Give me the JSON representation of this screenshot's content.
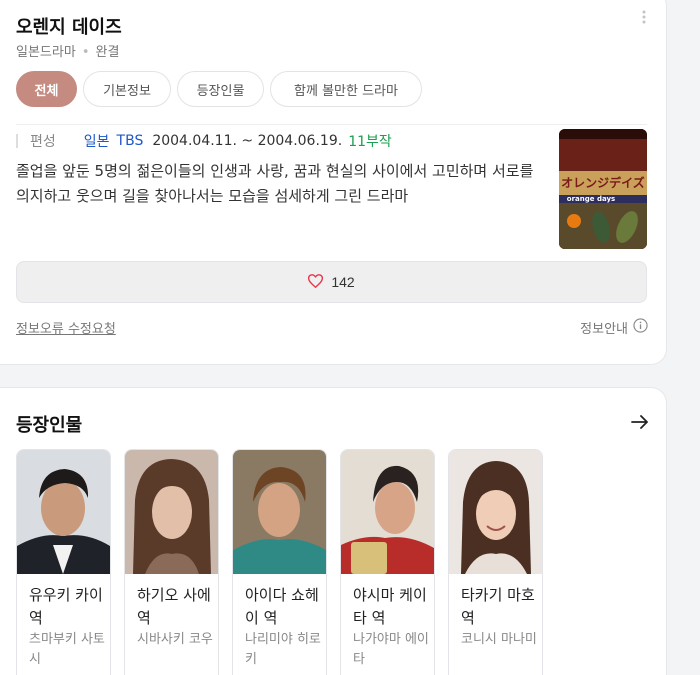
{
  "drama": {
    "title": "오렌지 데이즈",
    "genre": "일본드라마",
    "status": "완결",
    "more_icon": "more-vertical-icon"
  },
  "tabs": [
    {
      "label": "전체",
      "active": true
    },
    {
      "label": "기본정보",
      "active": false
    },
    {
      "label": "등장인물",
      "active": false
    },
    {
      "label": "함께 볼만한 드라마",
      "active": false
    }
  ],
  "broadcast": {
    "label": "편성",
    "country": "일본",
    "network": "TBS",
    "dates": "2004.04.11. ~ 2004.06.19.",
    "episodes": "11부작"
  },
  "synopsis": "졸업을 앞둔 5명의 젊은이들의 인생과 사랑, 꿈과 현실의 사이에서 고민하며 서로를 의지하고 웃으며 길을 찾아나서는 모습을 섬세하게 그린 드라마",
  "poster": {
    "title_jp": "オレンジデイズ",
    "title_en": "orange days"
  },
  "likes": {
    "count": "142",
    "icon": "heart-icon"
  },
  "footer": {
    "report_label": "정보오류 수정요청",
    "guide_label": "정보안내",
    "guide_icon": "info-icon"
  },
  "cast_section": {
    "title": "등장인물",
    "arrow_icon": "arrow-right-icon",
    "members": [
      {
        "role": "유우키 카이 역",
        "actor": "츠마부키 사토시"
      },
      {
        "role": "하기오 사에 역",
        "actor": "시바사키 코우"
      },
      {
        "role": "아이다 쇼헤이 역",
        "actor": "나리미야 히로키"
      },
      {
        "role": "야시마 케이타 역",
        "actor": "나가야마 에이타"
      },
      {
        "role": "타카기 마호 역",
        "actor": "코니시 마나미"
      }
    ]
  },
  "colors": {
    "accent": "#c58b80",
    "link_blue": "#1e57c8",
    "episode_green": "#1a9e4f"
  }
}
